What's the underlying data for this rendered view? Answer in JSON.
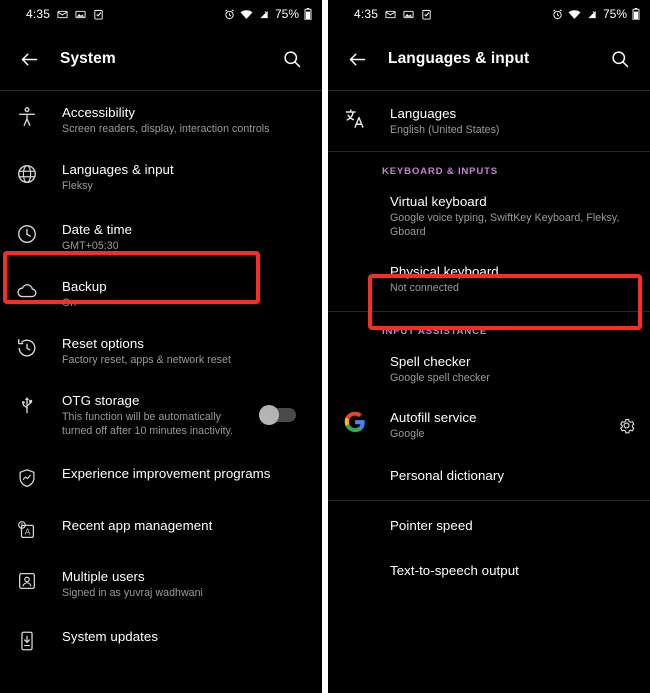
{
  "statusbar": {
    "time": "4:35",
    "left_icons": [
      "mail-icon",
      "image-icon",
      "task-done-icon"
    ],
    "right_icons": [
      "alarm-icon",
      "wifi-icon",
      "signal-icon"
    ],
    "battery_percent": "75%",
    "battery_icon": "battery-icon"
  },
  "colors": {
    "background": "#000000",
    "highlight": "#f72e21",
    "section_label": "#c77fd6",
    "title": "#ffffff",
    "subtitle": "#9b9b9b",
    "divider": "#2a2a2a"
  },
  "left_screen": {
    "appbar": {
      "back_icon": "back-arrow-icon",
      "title": "System",
      "search_icon": "search-icon"
    },
    "items": [
      {
        "icon": "accessibility-icon",
        "title": "Accessibility",
        "subtitle": "Screen readers, display, interaction controls",
        "highlighted": false
      },
      {
        "icon": "globe-icon",
        "title": "Languages & input",
        "subtitle": "Fleksy",
        "highlighted": true
      },
      {
        "icon": "clock-icon",
        "title": "Date & time",
        "subtitle": "GMT+05:30",
        "highlighted": false
      },
      {
        "icon": "cloud-icon",
        "title": "Backup",
        "subtitle": "On",
        "highlighted": false
      },
      {
        "icon": "history-icon",
        "title": "Reset options",
        "subtitle": "Factory reset, apps & network reset",
        "highlighted": false
      },
      {
        "icon": "usb-icon",
        "title": "OTG storage",
        "subtitle": "This function will be automatically turned off after 10 minutes inactivity.",
        "highlighted": false,
        "toggle": "off"
      },
      {
        "icon": "shield-chart-icon",
        "title": "Experience improvement programs",
        "subtitle": "",
        "highlighted": false
      },
      {
        "icon": "recent-apps-icon",
        "title": "Recent app management",
        "subtitle": "",
        "highlighted": false
      },
      {
        "icon": "person-box-icon",
        "title": "Multiple users",
        "subtitle": "Signed in as yuvraj wadhwani",
        "highlighted": false
      },
      {
        "icon": "system-update-icon",
        "title": "System updates",
        "subtitle": "",
        "highlighted": false
      }
    ]
  },
  "right_screen": {
    "appbar": {
      "back_icon": "back-arrow-icon",
      "title": "Languages & input",
      "search_icon": "search-icon"
    },
    "languages_item": {
      "icon": "translate-icon",
      "title": "Languages",
      "subtitle": "English (United States)"
    },
    "sections": [
      {
        "label": "KEYBOARD & INPUTS",
        "items": [
          {
            "title": "Virtual keyboard",
            "subtitle": "Google voice typing, SwiftKey Keyboard, Fleksy, Gboard",
            "highlighted": true
          },
          {
            "title": "Physical keyboard",
            "subtitle": "Not connected",
            "highlighted": false
          }
        ]
      },
      {
        "label": "INPUT ASSISTANCE",
        "items": [
          {
            "title": "Spell checker",
            "subtitle": "Google spell checker",
            "highlighted": false
          },
          {
            "title": "Autofill service",
            "subtitle": "Google",
            "icon": "google-g-icon",
            "trailing_icon": "gear-icon",
            "highlighted": false
          },
          {
            "title": "Personal dictionary",
            "subtitle": "",
            "highlighted": false
          },
          {
            "title": "Pointer speed",
            "subtitle": "",
            "highlighted": false
          },
          {
            "title": "Text-to-speech output",
            "subtitle": "",
            "highlighted": false
          }
        ]
      }
    ]
  }
}
